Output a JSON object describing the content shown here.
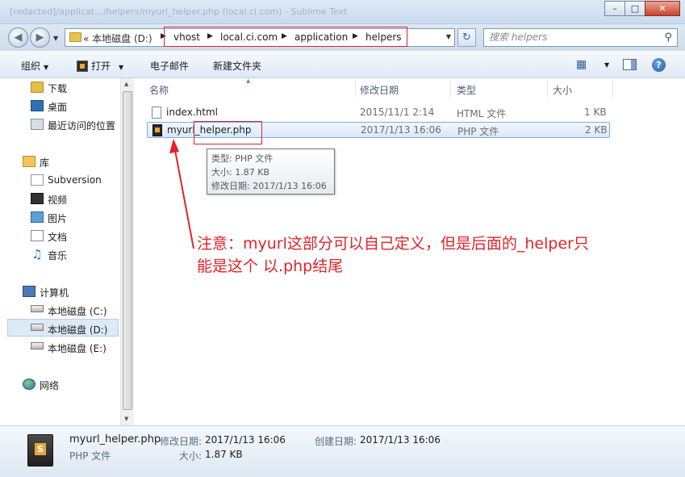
{
  "window": {
    "title": "[redacted]/applicat…/helpers/myurl_helper.php (local.ci.com) - Sublime Text",
    "minimize": "–",
    "maximize": "□",
    "close": "✕"
  },
  "address": {
    "first": "«  本地磁盘 (D:)",
    "crumbs": [
      "vhost",
      "local.ci.com",
      "application",
      "helpers"
    ],
    "search_placeholder": "搜索 helpers"
  },
  "toolbar": {
    "organize": "组织",
    "open": "打开",
    "email": "电子邮件",
    "new_folder": "新建文件夹",
    "help": "?"
  },
  "sidebar": {
    "favorites": [
      "下载",
      "桌面",
      "最近访问的位置"
    ],
    "library_label": "库",
    "libraries": [
      "Subversion",
      "视频",
      "图片",
      "文档",
      "音乐"
    ],
    "computer_label": "计算机",
    "drives": [
      "本地磁盘 (C:)",
      "本地磁盘 (D:)",
      "本地磁盘 (E:)"
    ],
    "selected_drive": "本地磁盘 (D:)",
    "network_label": "网络"
  },
  "columns": {
    "name": "名称",
    "modified": "修改日期",
    "type": "类型",
    "size": "大小"
  },
  "files": [
    {
      "name": "index.html",
      "modified": "2015/11/1 2:14",
      "type": "HTML 文件",
      "size": "1 KB",
      "selected": false
    },
    {
      "name": "myurl_helper.php",
      "modified": "2017/1/13 16:06",
      "type": "PHP 文件",
      "size": "2 KB",
      "selected": true
    }
  ],
  "tooltip": {
    "type": "类型: PHP 文件",
    "size": "大小: 1.87 KB",
    "modified": "修改日期: 2017/1/13 16:06"
  },
  "annotation": {
    "line1": "注意：myurl这部分可以自己定义，但是后面的_helper只",
    "line2": "能是这个 以.php结尾",
    "color": "#e0242a"
  },
  "details": {
    "filename": "myurl_helper.php",
    "filetype": "PHP 文件",
    "modified_label": "修改日期:",
    "modified_value": "2017/1/13 16:06",
    "created_label": "创建日期:",
    "created_value": "2017/1/13 16:06",
    "size_label": "大小:",
    "size_value": "1.87 KB"
  },
  "colors": {
    "selection": "#dce9f7",
    "accent": "#2f6bb0",
    "annotation_red": "#e0242a"
  }
}
